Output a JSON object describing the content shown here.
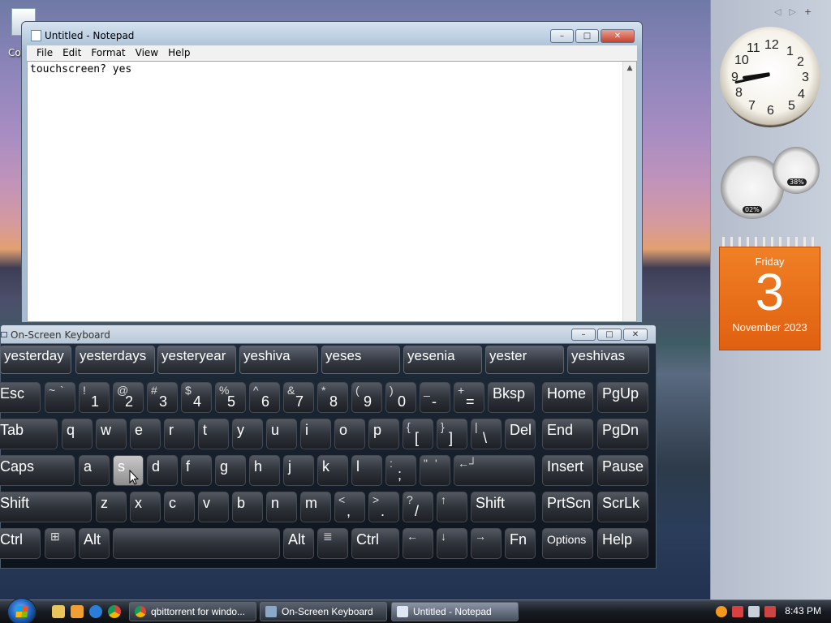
{
  "desktop": {
    "icon_label": "Co"
  },
  "notepad": {
    "title": "Untitled - Notepad",
    "menu": [
      "File",
      "Edit",
      "Format",
      "View",
      "Help"
    ],
    "content": "touchscreen? yes",
    "buttons": {
      "minimize": "–",
      "maximize": "□",
      "close": "✕"
    }
  },
  "osk": {
    "title": "On-Screen Keyboard",
    "buttons": {
      "minimize": "–",
      "maximize": "□",
      "close": "✕"
    },
    "suggestions": [
      "yesterday",
      "yesterdays",
      "yesteryear",
      "yeshiva",
      "yeses",
      "yesenia",
      "yester",
      "yeshivas"
    ],
    "keys": {
      "esc": "Esc",
      "tilde_top": "~",
      "tilde_bot": "`",
      "n1t": "!",
      "n1": "1",
      "n2t": "@",
      "n2": "2",
      "n3t": "#",
      "n3": "3",
      "n4t": "$",
      "n4": "4",
      "n5t": "%",
      "n5": "5",
      "n6t": "^",
      "n6": "6",
      "n7t": "&",
      "n7": "7",
      "n8t": "*",
      "n8": "8",
      "n9t": "(",
      "n9": "9",
      "n0t": ")",
      "n0": "0",
      "minus_t": "_",
      "minus": "-",
      "eq_t": "+",
      "eq": "=",
      "bksp": "Bksp",
      "home": "Home",
      "pgup": "PgUp",
      "tab": "Tab",
      "q": "q",
      "w": "w",
      "e": "e",
      "r": "r",
      "t": "t",
      "y": "y",
      "u": "u",
      "i": "i",
      "o": "o",
      "p": "p",
      "lbr_t": "{",
      "lbr": "[",
      "rbr_t": "}",
      "rbr": "]",
      "bs_t": "|",
      "bs": "\\",
      "del": "Del",
      "end": "End",
      "pgdn": "PgDn",
      "caps": "Caps",
      "a": "a",
      "s": "s",
      "d": "d",
      "f": "f",
      "g": "g",
      "h": "h",
      "j": "j",
      "k": "k",
      "l": "l",
      "semi_t": ":",
      "semi": ";",
      "quote_t": "\"",
      "quote": "'",
      "enter": "←┘",
      "insert": "Insert",
      "pause": "Pause",
      "lshift": "Shift",
      "z": "z",
      "x": "x",
      "c": "c",
      "v": "v",
      "b": "b",
      "n": "n",
      "m": "m",
      "comma_t": "<",
      "comma": ",",
      "period_t": ">",
      "period": ".",
      "slash_t": "?",
      "slash": "/",
      "up": "↑",
      "rshift": "Shift",
      "prtscn": "PrtScn",
      "scrlk": "ScrLk",
      "lctrl": "Ctrl",
      "win": "⊞",
      "lalt": "Alt",
      "ralt": "Alt",
      "menu": "≣",
      "rctrl": "Ctrl",
      "left": "←",
      "down": "↓",
      "right": "→",
      "fn": "Fn",
      "options": "Options",
      "help": "Help"
    }
  },
  "sidebar": {
    "nav_prev": "◁",
    "nav_next": "▷",
    "add": "+",
    "clock": {
      "numbers": [
        "12",
        "1",
        "2",
        "3",
        "4",
        "5",
        "6",
        "7",
        "8",
        "9",
        "10",
        "11"
      ],
      "hour": 8,
      "minute": 43
    },
    "cpu_meter": {
      "cpu": "02%",
      "memory": "38%"
    },
    "calendar": {
      "weekday": "Friday",
      "day": "3",
      "month_year": "November 2023"
    }
  },
  "taskbar": {
    "tasks": [
      "qbittorrent for windo...",
      "On-Screen Keyboard",
      "Untitled - Notepad"
    ],
    "time": "8:43 PM"
  }
}
